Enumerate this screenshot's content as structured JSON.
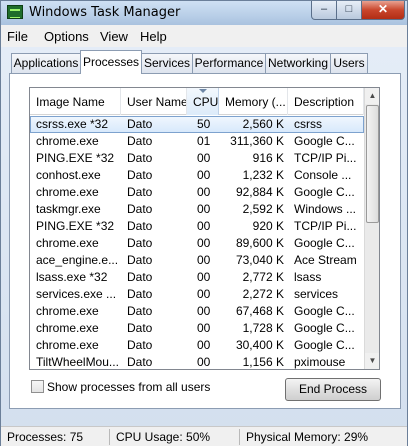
{
  "window": {
    "title": "Windows Task Manager",
    "controls": {
      "minimize": "‒",
      "maximize": "□",
      "close": "✕"
    }
  },
  "menu": [
    "File",
    "Options",
    "View",
    "Help"
  ],
  "tabs": [
    "Applications",
    "Processes",
    "Services",
    "Performance",
    "Networking",
    "Users"
  ],
  "active_tab": "Processes",
  "columns": [
    "Image Name",
    "User Name",
    "CPU",
    "Memory (...",
    "Description"
  ],
  "sorted_column": "CPU",
  "processes": [
    {
      "name": "csrss.exe *32",
      "user": "Dato",
      "cpu": "50",
      "memory": "2,560 K",
      "description": "csrss"
    },
    {
      "name": "chrome.exe",
      "user": "Dato",
      "cpu": "01",
      "memory": "311,360 K",
      "description": "Google C..."
    },
    {
      "name": "PING.EXE *32",
      "user": "Dato",
      "cpu": "00",
      "memory": "916 K",
      "description": "TCP/IP Pi..."
    },
    {
      "name": "conhost.exe",
      "user": "Dato",
      "cpu": "00",
      "memory": "1,232 K",
      "description": "Console ..."
    },
    {
      "name": "chrome.exe",
      "user": "Dato",
      "cpu": "00",
      "memory": "92,884 K",
      "description": "Google C..."
    },
    {
      "name": "taskmgr.exe",
      "user": "Dato",
      "cpu": "00",
      "memory": "2,592 K",
      "description": "Windows ..."
    },
    {
      "name": "PING.EXE *32",
      "user": "Dato",
      "cpu": "00",
      "memory": "920 K",
      "description": "TCP/IP Pi..."
    },
    {
      "name": "chrome.exe",
      "user": "Dato",
      "cpu": "00",
      "memory": "89,600 K",
      "description": "Google C..."
    },
    {
      "name": "ace_engine.e...",
      "user": "Dato",
      "cpu": "00",
      "memory": "73,040 K",
      "description": "Ace Stream"
    },
    {
      "name": "lsass.exe *32",
      "user": "Dato",
      "cpu": "00",
      "memory": "2,772 K",
      "description": "lsass"
    },
    {
      "name": "services.exe ...",
      "user": "Dato",
      "cpu": "00",
      "memory": "2,272 K",
      "description": "services"
    },
    {
      "name": "chrome.exe",
      "user": "Dato",
      "cpu": "00",
      "memory": "67,468 K",
      "description": "Google C..."
    },
    {
      "name": "chrome.exe",
      "user": "Dato",
      "cpu": "00",
      "memory": "1,728 K",
      "description": "Google C..."
    },
    {
      "name": "chrome.exe",
      "user": "Dato",
      "cpu": "00",
      "memory": "30,400 K",
      "description": "Google C..."
    },
    {
      "name": "TiltWheelMou...",
      "user": "Dato",
      "cpu": "00",
      "memory": "1,156 K",
      "description": "pximouse"
    }
  ],
  "selected_row": "csrss.exe *32",
  "show_all_processes": {
    "label": "Show processes from all users",
    "checked": false
  },
  "end_process_label": "End Process",
  "status": {
    "processes": "Processes: 75",
    "cpu": "CPU Usage: 50%",
    "memory": "Physical Memory: 29%"
  },
  "colors": {
    "selection": "#d6e8fb",
    "selection_border": "#7da2ce",
    "close_button": "#c9462c"
  },
  "icons": [
    "task-manager-icon",
    "minimize-icon",
    "maximize-icon",
    "close-icon",
    "sort-indicator-icon",
    "scroll-up-icon",
    "scroll-down-icon"
  ]
}
